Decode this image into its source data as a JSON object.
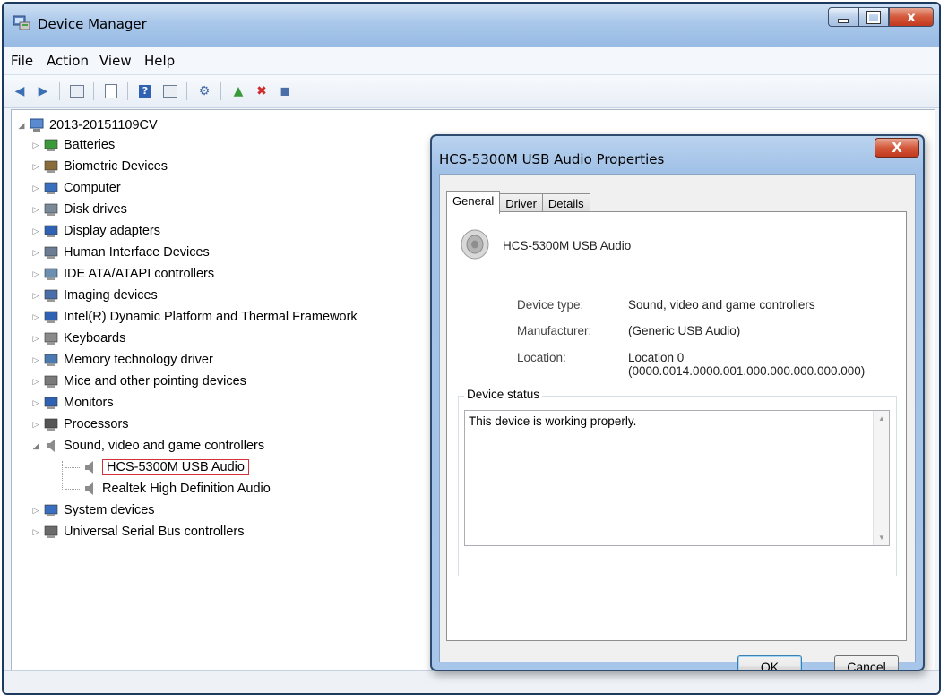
{
  "window": {
    "title": "Device Manager",
    "icon": "device-manager-icon",
    "controls": {
      "minimize": "minimize",
      "maximize": "maximize",
      "close": "x"
    }
  },
  "menu": [
    "File",
    "Action",
    "View",
    "Help"
  ],
  "toolbar": [
    "back-icon",
    "forward-icon",
    "show-hide-console-tree-icon",
    "properties-icon",
    "help-icon",
    "view-icon",
    "scan-hardware-icon",
    "update-driver-icon",
    "uninstall-icon",
    "disable-icon"
  ],
  "tree": {
    "root": "2013-20151109CV",
    "items": [
      {
        "label": "Batteries",
        "icon": "battery-icon"
      },
      {
        "label": "Biometric Devices",
        "icon": "fingerprint-icon"
      },
      {
        "label": "Computer",
        "icon": "computer-icon"
      },
      {
        "label": "Disk drives",
        "icon": "disk-drive-icon"
      },
      {
        "label": "Display adapters",
        "icon": "display-adapter-icon"
      },
      {
        "label": "Human Interface Devices",
        "icon": "hid-icon"
      },
      {
        "label": "IDE ATA/ATAPI controllers",
        "icon": "ide-controller-icon"
      },
      {
        "label": "Imaging devices",
        "icon": "camera-icon"
      },
      {
        "label": "Intel(R) Dynamic Platform and Thermal Framework",
        "icon": "chip-icon"
      },
      {
        "label": "Keyboards",
        "icon": "keyboard-icon"
      },
      {
        "label": "Memory technology driver",
        "icon": "memory-icon"
      },
      {
        "label": "Mice and other pointing devices",
        "icon": "mouse-icon"
      },
      {
        "label": "Monitors",
        "icon": "monitor-icon"
      },
      {
        "label": "Processors",
        "icon": "processor-icon"
      },
      {
        "label": "Sound, video and game controllers",
        "icon": "speaker-icon",
        "expanded": true
      },
      {
        "label": "HCS-5300M USB Audio",
        "icon": "speaker-icon",
        "child": true,
        "highlighted": true
      },
      {
        "label": "Realtek High Definition Audio",
        "icon": "speaker-icon",
        "child": true
      },
      {
        "label": "System devices",
        "icon": "system-device-icon"
      },
      {
        "label": "Universal Serial Bus controllers",
        "icon": "usb-icon"
      }
    ]
  },
  "dialog": {
    "title": "HCS-5300M USB Audio Properties",
    "close": "X",
    "tabs": [
      "General",
      "Driver",
      "Details"
    ],
    "device_name": "HCS-5300M USB Audio",
    "fields": {
      "device_type_label": "Device type:",
      "device_type": "Sound, video and game controllers",
      "manufacturer_label": "Manufacturer:",
      "manufacturer": "(Generic USB Audio)",
      "location_label": "Location:",
      "location_line1": "Location 0",
      "location_line2": "(0000.0014.0000.001.000.000.000.000.000)"
    },
    "status_title": "Device status",
    "status_text": "This device is working properly.",
    "ok": "OK",
    "cancel": "Cancel"
  }
}
